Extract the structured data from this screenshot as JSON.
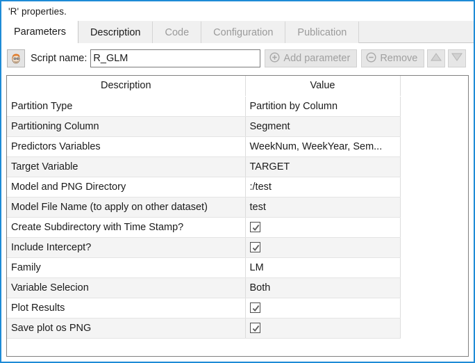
{
  "window": {
    "title": "'R' properties.",
    "accent_color": "#1e8bd6"
  },
  "tabs": [
    {
      "label": "Parameters",
      "state": "active"
    },
    {
      "label": "Description",
      "state": "enabled"
    },
    {
      "label": "Code",
      "state": "disabled"
    },
    {
      "label": "Configuration",
      "state": "disabled"
    },
    {
      "label": "Publication",
      "state": "disabled"
    }
  ],
  "toolbar": {
    "script_icon": "script-face-icon",
    "script_label": "Script name:",
    "script_value": "R_GLM",
    "add_parameter_label": "Add parameter",
    "add_parameter_icon": "circle-plus-icon",
    "remove_label": "Remove",
    "remove_icon": "circle-minus-icon",
    "move_up_icon": "triangle-up-icon",
    "move_down_icon": "triangle-down-icon"
  },
  "table": {
    "headers": [
      "Description",
      "Value"
    ],
    "rows": [
      {
        "description": "Partition Type",
        "value": "Partition by Column",
        "type": "text"
      },
      {
        "description": "Partitioning Column",
        "value": "Segment",
        "type": "text"
      },
      {
        "description": "Predictors Variables",
        "value": "WeekNum, WeekYear, Sem...",
        "type": "text"
      },
      {
        "description": "Target Variable",
        "value": "TARGET",
        "type": "text"
      },
      {
        "description": "Model and PNG Directory",
        "value": ":/test",
        "type": "text"
      },
      {
        "description": "Model File Name (to apply on other dataset)",
        "value": "test",
        "type": "text"
      },
      {
        "description": "Create Subdirectory with Time Stamp?",
        "value": "checked",
        "type": "checkbox"
      },
      {
        "description": "Include Intercept?",
        "value": "checked",
        "type": "checkbox"
      },
      {
        "description": "Family",
        "value": "LM",
        "type": "text"
      },
      {
        "description": "Variable Selecion",
        "value": "Both",
        "type": "text"
      },
      {
        "description": "Plot Results",
        "value": "checked",
        "type": "checkbox"
      },
      {
        "description": "Save plot os PNG",
        "value": "checked",
        "type": "checkbox"
      }
    ]
  }
}
